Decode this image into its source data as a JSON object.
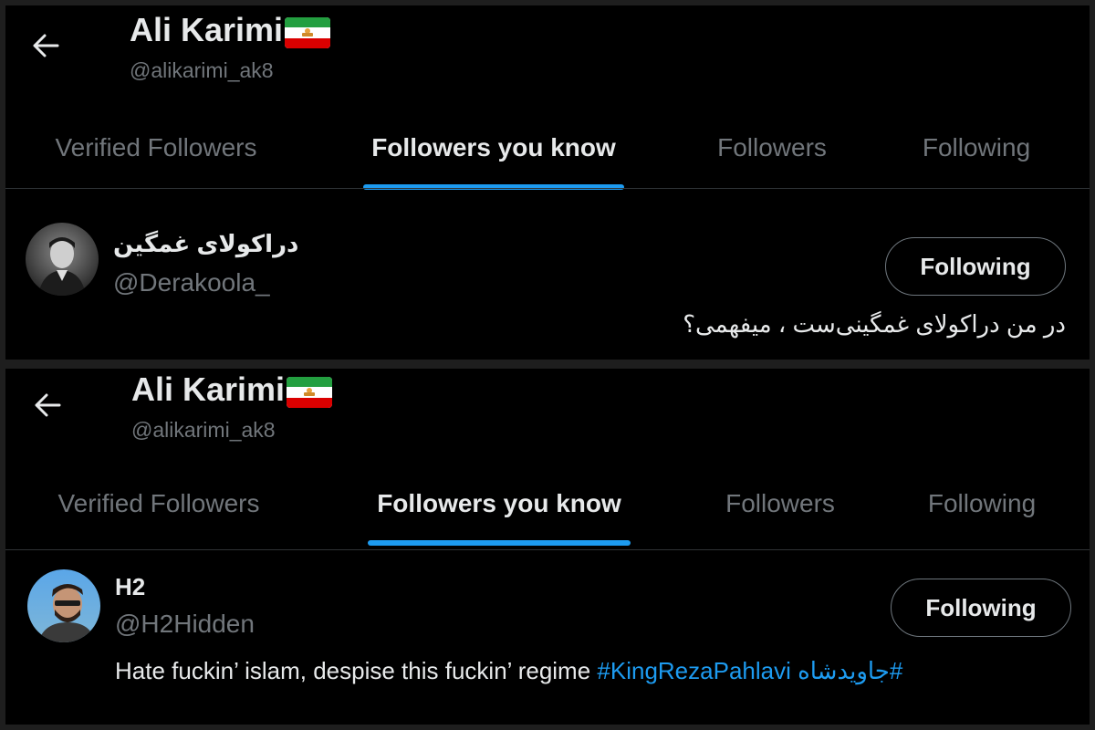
{
  "panels": [
    {
      "header": {
        "name": "Ali Karimi",
        "handle": "@alikarimi_ak8",
        "flag_icon": "iran-lion-and-sun-flag-icon"
      },
      "tabs": [
        {
          "label": "Verified Followers",
          "active": false
        },
        {
          "label": "Followers you know",
          "active": true
        },
        {
          "label": "Followers",
          "active": false
        },
        {
          "label": "Following",
          "active": false
        }
      ],
      "user": {
        "display_name": "دراکولای غمگین",
        "handle": "@Derakoola_",
        "button_label": "Following",
        "bio": "در من دراکولای غمگینی‌ست ، میفهمی؟",
        "bio_hashtags": []
      }
    },
    {
      "header": {
        "name": "Ali Karimi",
        "handle": "@alikarimi_ak8",
        "flag_icon": "iran-lion-and-sun-flag-icon"
      },
      "tabs": [
        {
          "label": "Verified Followers",
          "active": false
        },
        {
          "label": "Followers you know",
          "active": true
        },
        {
          "label": "Followers",
          "active": false
        },
        {
          "label": "Following",
          "active": false
        }
      ],
      "user": {
        "display_name": "H2",
        "handle": "@H2Hidden",
        "button_label": "Following",
        "bio": "Hate fuckin’ islam, despise this fuckin’ regime",
        "bio_hashtags": [
          "#KingRezaPahlavi",
          "#جاویدشاه"
        ]
      }
    }
  ],
  "colors": {
    "accent": "#1d9bf0",
    "background": "#000000",
    "muted_text": "#71767b",
    "primary_text": "#e7e9ea",
    "divider": "#2f3336"
  }
}
